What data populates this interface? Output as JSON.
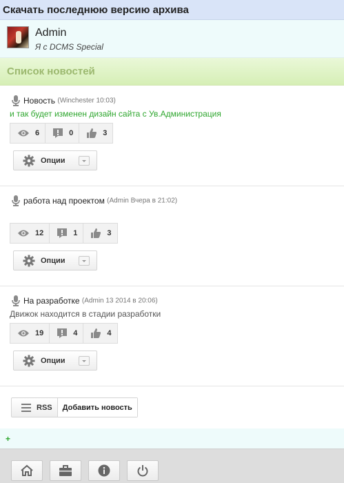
{
  "top": {
    "title": "Скачать последнюю версию архива"
  },
  "user": {
    "name": "Admin",
    "status": "Я с DCMS Special"
  },
  "section": {
    "title": "Список новостей"
  },
  "news": [
    {
      "title": "Новость",
      "meta": "(Winchester 10:03)",
      "body": "и так будет изменен дизайн сайта с Ув.Администрация",
      "body_color": "#2ea62e",
      "views": "6",
      "comments": "0",
      "likes": "3",
      "options_label": "Опции"
    },
    {
      "title": "работа над проектом",
      "meta": "(Admin Вчера в 21:02)",
      "body": "",
      "body_color": "#555555",
      "views": "12",
      "comments": "1",
      "likes": "3",
      "options_label": "Опции"
    },
    {
      "title": "На разработке",
      "meta": "(Admin 13 2014 в 20:06)",
      "body": "Движок находится в стадии разработки",
      "body_color": "#555555",
      "views": "19",
      "comments": "4",
      "likes": "4",
      "options_label": "Опции"
    }
  ],
  "actions": {
    "rss_label": "RSS",
    "add_label": "Добавить новость"
  },
  "icons": {
    "mic": "microphone-icon",
    "views": "eye-icon",
    "comments": "comment-alert-icon",
    "likes": "thumbs-up-icon",
    "options": "gear-icon",
    "rss": "list-icon",
    "plus": "plus-icon",
    "nav": [
      "home-icon",
      "briefcase-icon",
      "info-icon",
      "power-icon"
    ]
  },
  "colors": {
    "accent_green": "#2ea62e",
    "section_title": "#9bb86e",
    "top_bar": "#d9e4f8"
  }
}
